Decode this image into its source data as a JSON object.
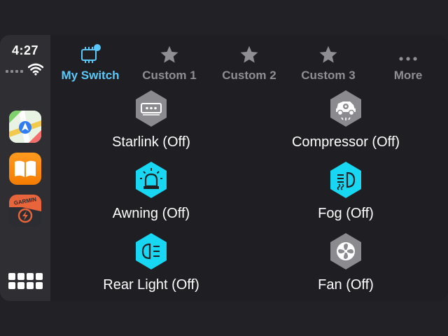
{
  "status": {
    "time": "4:27"
  },
  "dock": {
    "apps": [
      {
        "name": "maps"
      },
      {
        "name": "books"
      },
      {
        "name": "garmin",
        "logo_text": "GARMIN"
      }
    ]
  },
  "tabs": [
    {
      "label": "My Switch",
      "icon": "chip-icon",
      "active": true
    },
    {
      "label": "Custom 1",
      "icon": "star-icon"
    },
    {
      "label": "Custom 2",
      "icon": "star-icon"
    },
    {
      "label": "Custom 3",
      "icon": "star-icon"
    },
    {
      "label": "More",
      "icon": "dots-icon"
    }
  ],
  "switches": [
    {
      "label": "Starlink (Off)",
      "icon": "starlink-icon",
      "color": "#8a8a8f"
    },
    {
      "label": "Compressor (Off)",
      "icon": "compressor-icon",
      "color": "#8a8a8f"
    },
    {
      "label": "Awning (Off)",
      "icon": "beacon-icon",
      "color": "#18d7f2"
    },
    {
      "label": "Fog (Off)",
      "icon": "fog-light-icon",
      "color": "#18d7f2"
    },
    {
      "label": "Rear Light (Off)",
      "icon": "rear-light-icon",
      "color": "#18d7f2"
    },
    {
      "label": "Fan (Off)",
      "icon": "fan-icon",
      "color": "#8a8a8f"
    }
  ],
  "colors": {
    "accent": "#5ac8fa",
    "active_switch": "#18d7f2",
    "inactive_switch": "#8a8a8f"
  }
}
